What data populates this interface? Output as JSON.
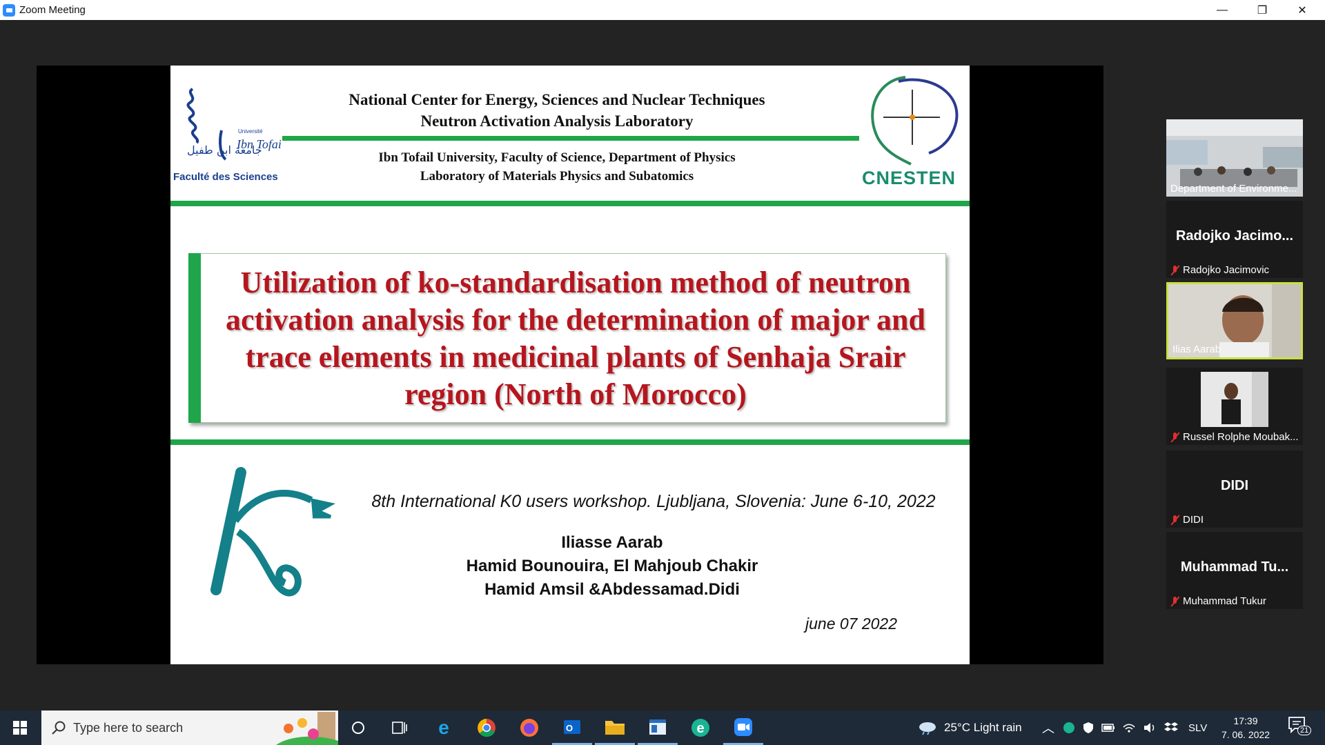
{
  "window": {
    "title": "Zoom Meeting",
    "minimize_label": "—",
    "maximize_label": "❐",
    "close_label": "✕"
  },
  "slide": {
    "logo_left_caption": "Faculté des Sciences",
    "logo_left_university": "Université",
    "logo_left_name": "Ibn Tofail",
    "header1_line1": "National Center for Energy, Sciences and Nuclear Techniques",
    "header1_line2": "Neutron Activation Analysis Laboratory",
    "header2_line1": "Ibn Tofail University, Faculty of Science, Department of Physics",
    "header2_line2": "Laboratory of Materials Physics and Subatomics",
    "logo_right_text": "CNESTEN",
    "title": "Utilization of ko-standardisation method of neutron activation analysis for the determination of major and trace elements in medicinal plants of Senhaja Srair region (North of Morocco)",
    "workshop": "8th International K0 users workshop. Ljubljana, Slovenia: June 6-10, 2022",
    "author1": "Iliasse Aarab",
    "author2": "Hamid Bounouira, El Mahjoub Chakir",
    "author3": "Hamid Amsil &Abdessamad.Didi",
    "date": "june 07 2022"
  },
  "participants": [
    {
      "name": "Department of Environme...",
      "type": "video-room",
      "muted": false
    },
    {
      "display": "Radojko  Jacimo...",
      "name": "Radojko Jacimovic",
      "type": "avatar",
      "muted": true
    },
    {
      "name": "Ilias Aarab",
      "type": "video-person",
      "muted": false,
      "speaking": true
    },
    {
      "name": "Russel Rolphe Moubak...",
      "type": "photo",
      "muted": true
    },
    {
      "display": "DIDI",
      "name": "DIDI",
      "type": "avatar",
      "muted": true
    },
    {
      "display": "Muhammad  Tu...",
      "name": "Muhammad Tukur",
      "type": "avatar",
      "muted": true
    }
  ],
  "taskbar": {
    "search_placeholder": "Type here to search",
    "weather": "25°C  Light rain",
    "language": "SLV",
    "time": "17:39",
    "date": "7. 06. 2022",
    "notifications": "21"
  },
  "colors": {
    "slide_green": "#1fa64a",
    "title_red": "#b5161e",
    "cnesten_teal": "#1a8c6e",
    "ko_teal": "#13808a",
    "speaking_border": "#c8e044"
  }
}
